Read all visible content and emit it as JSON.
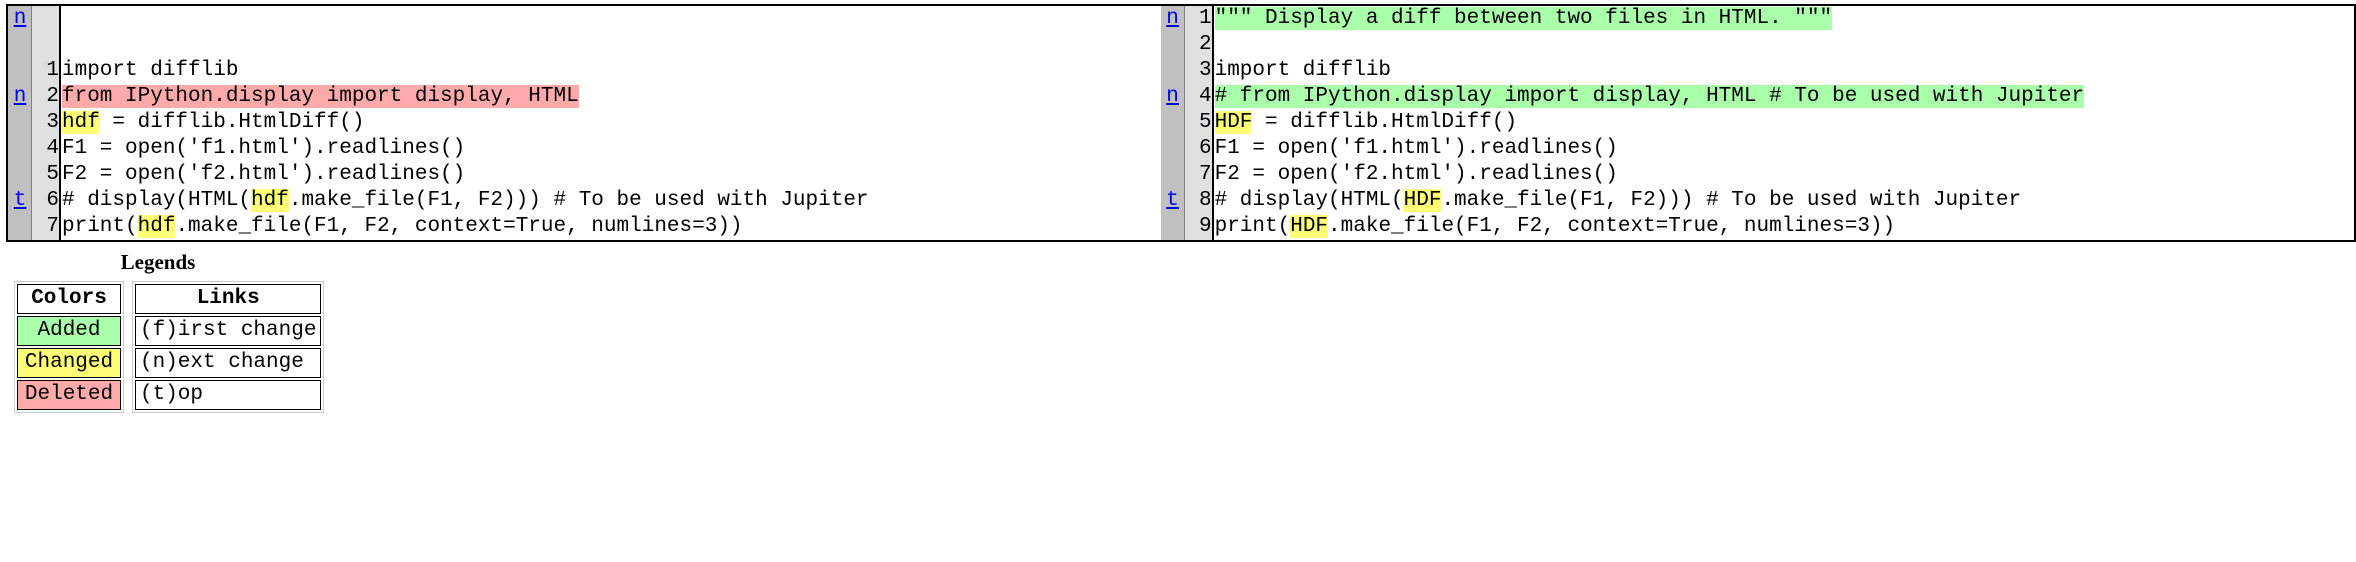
{
  "diff": {
    "left": {
      "rows": [
        {
          "link": "n",
          "link_href": "#difflib_chg_to0__0",
          "lineno": "",
          "segments": []
        },
        {
          "link": "",
          "link_href": "",
          "lineno": "",
          "segments": []
        },
        {
          "link": "",
          "link_href": "",
          "lineno": "1",
          "segments": [
            {
              "text": "import difflib",
              "cls": ""
            }
          ]
        },
        {
          "link": "n",
          "link_href": "#difflib_chg_to0__1",
          "lineno": "2",
          "segments": [
            {
              "text": "from IPython.display import display, HTML",
              "cls": "diff_sub"
            }
          ]
        },
        {
          "link": "",
          "link_href": "",
          "lineno": "3",
          "segments": [
            {
              "text": "hdf",
              "cls": "diff_chg"
            },
            {
              "text": " = difflib.HtmlDiff()",
              "cls": ""
            }
          ]
        },
        {
          "link": "",
          "link_href": "",
          "lineno": "4",
          "segments": [
            {
              "text": "F1 = open('f1.html').readlines()",
              "cls": ""
            }
          ]
        },
        {
          "link": "",
          "link_href": "",
          "lineno": "5",
          "segments": [
            {
              "text": "F2 = open('f2.html').readlines()",
              "cls": ""
            }
          ]
        },
        {
          "link": "t",
          "link_href": "#difflib_chg_to0__top",
          "lineno": "6",
          "segments": [
            {
              "text": "# display(HTML(",
              "cls": ""
            },
            {
              "text": "hdf",
              "cls": "diff_chg"
            },
            {
              "text": ".make_file(F1, F2))) # To be used with Jupiter",
              "cls": ""
            }
          ]
        },
        {
          "link": "",
          "link_href": "",
          "lineno": "7",
          "segments": [
            {
              "text": "print(",
              "cls": ""
            },
            {
              "text": "hdf",
              "cls": "diff_chg"
            },
            {
              "text": ".make_file(F1, F2, context=True, numlines=3))",
              "cls": ""
            }
          ]
        }
      ]
    },
    "right": {
      "rows": [
        {
          "link": "n",
          "link_href": "#difflib_chg_to0__0",
          "lineno": "1",
          "segments": [
            {
              "text": "\"\"\" Display a diff between two files in HTML. \"\"\"",
              "cls": "diff_add"
            }
          ]
        },
        {
          "link": "",
          "link_href": "",
          "lineno": "2",
          "segments": [
            {
              "text": "  ",
              "cls": "diff_add"
            }
          ]
        },
        {
          "link": "",
          "link_href": "",
          "lineno": "3",
          "segments": [
            {
              "text": "import difflib",
              "cls": ""
            }
          ]
        },
        {
          "link": "n",
          "link_href": "#difflib_chg_to0__1",
          "lineno": "4",
          "segments": [
            {
              "text": "# from IPython.display import display, HTML # To be used with Jupiter",
              "cls": "diff_add"
            }
          ]
        },
        {
          "link": "",
          "link_href": "",
          "lineno": "5",
          "segments": [
            {
              "text": "HDF",
              "cls": "diff_chg"
            },
            {
              "text": " = difflib.HtmlDiff()",
              "cls": ""
            }
          ]
        },
        {
          "link": "",
          "link_href": "",
          "lineno": "6",
          "segments": [
            {
              "text": "F1 = open('f1.html').readlines()",
              "cls": ""
            }
          ]
        },
        {
          "link": "",
          "link_href": "",
          "lineno": "7",
          "segments": [
            {
              "text": "F2 = open('f2.html').readlines()",
              "cls": ""
            }
          ]
        },
        {
          "link": "t",
          "link_href": "#difflib_chg_to0__top",
          "lineno": "8",
          "segments": [
            {
              "text": "# display(HTML(",
              "cls": ""
            },
            {
              "text": "HDF",
              "cls": "diff_chg"
            },
            {
              "text": ".make_file(F1, F2))) # To be used with Jupiter",
              "cls": ""
            }
          ]
        },
        {
          "link": "",
          "link_href": "",
          "lineno": "9",
          "segments": [
            {
              "text": "print(",
              "cls": ""
            },
            {
              "text": "HDF",
              "cls": "diff_chg"
            },
            {
              "text": ".make_file(F1, F2, context=True, numlines=3))",
              "cls": ""
            }
          ]
        }
      ]
    }
  },
  "legends": {
    "title": "Legends",
    "colors": {
      "header": "Colors",
      "rows": [
        {
          "label": "Added",
          "cls": "diff_add",
          "color": "#aaffaa"
        },
        {
          "label": "Changed",
          "cls": "diff_chg",
          "color": "#ffff77"
        },
        {
          "label": "Deleted",
          "cls": "diff_sub",
          "color": "#ffaaaa"
        }
      ]
    },
    "links": {
      "header": "Links",
      "rows": [
        {
          "label": "(f)irst change",
          "href": "#difflib_chg_to0__0"
        },
        {
          "label": "(n)ext change",
          "href": "#difflib_chg_to0__1"
        },
        {
          "label": "(t)op",
          "href": "#difflib_chg_to0__top"
        }
      ]
    }
  }
}
